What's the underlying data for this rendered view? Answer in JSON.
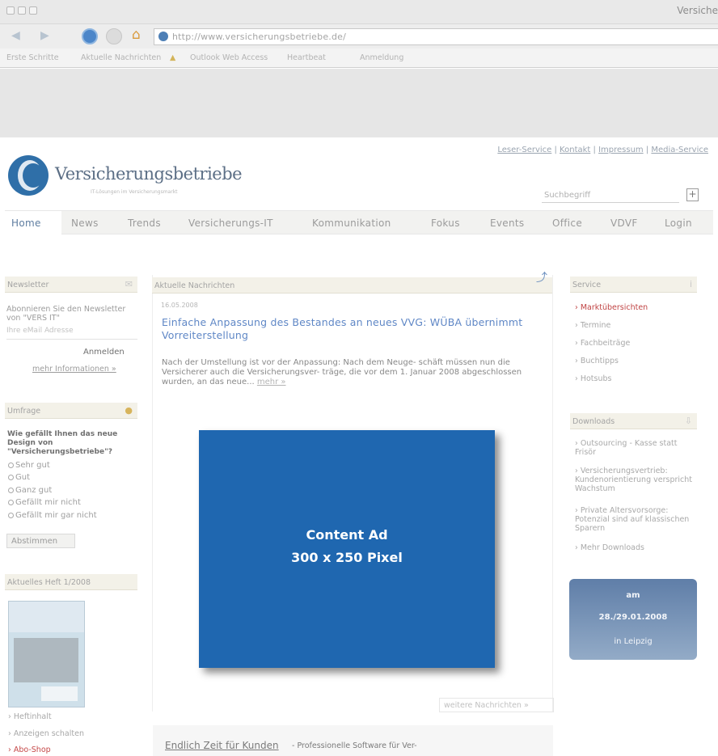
{
  "browser": {
    "window_title": "Versiche",
    "url": "http://www.versicherungsbetriebe.de/",
    "bookmarks": [
      "Erste Schritte",
      "Aktuelle Nachrichten",
      "Outlook Web Access",
      "Heartbeat",
      "Anmeldung"
    ]
  },
  "header": {
    "top_links": [
      "Leser-Service",
      "Kontakt",
      "Impressum",
      "Media-Service"
    ],
    "logo_text": "Versicherungsbetriebe",
    "logo_sub": "IT-Lösungen im Versicherungsmarkt",
    "search_placeholder": "Suchbegriff",
    "search_button": "+"
  },
  "nav": [
    "Home",
    "News",
    "Trends",
    "Versicherungs-IT",
    "Kommunikation",
    "Fokus",
    "Events",
    "Office",
    "VDVF",
    "Login"
  ],
  "left": {
    "newsletter": {
      "title": "Newsletter",
      "text": "Abonnieren Sie den Newsletter von \"VERS IT\"",
      "placeholder": "Ihre eMail Adresse",
      "button": "Anmelden",
      "more": "mehr Informationen »"
    },
    "poll": {
      "title": "Umfrage",
      "question": "Wie gefällt Ihnen das neue Design von \"Versicherungsbetriebe\"?",
      "options": [
        "Sehr gut",
        "Gut",
        "Ganz gut",
        "Gefällt mir nicht",
        "Gefällt mir gar nicht"
      ],
      "button": "Abstimmen"
    },
    "issue": {
      "title": "Aktuelles Heft 1/2008",
      "links": [
        "Heftinhalt",
        "Anzeigen schalten",
        "Abo-Shop"
      ]
    }
  },
  "main": {
    "section_title": "Aktuelle Nachrichten",
    "date": "16.05.2008",
    "article_title": "Einfache Anpassung des Bestandes an neues VVG: WÜBA übernimmt Vorreiterstellung",
    "article_body": "Nach der Umstellung ist vor der Anpassung: Nach dem Neuge- schäft müssen nun die Versicherer auch die Versicherungsver- träge, die vor dem 1. Januar 2008 abgeschlossen wurden, an das neue...",
    "more_link": "mehr »",
    "ad_line1": "Content Ad",
    "ad_line2": "300 x 250 Pixel",
    "more_news": "weitere Nachrichten »",
    "teaser_title": "Endlich Zeit für Kunden",
    "teaser_text": "- Professionelle Software für Ver-"
  },
  "right": {
    "service": {
      "title": "Service",
      "links": [
        "Marktübersichten",
        "Termine",
        "Fachbeiträge",
        "Buchtipps",
        "Hotsubs"
      ]
    },
    "downloads": {
      "title": "Downloads",
      "links": [
        "Outsourcing - Kasse statt Frisör",
        "Versicherungsvertrieb: Kundenorientierung verspricht Wachstum",
        "Private Altersvorsorge: Potenzial sind auf klassischen Sparern",
        "Mehr Downloads"
      ]
    },
    "event": {
      "label": "am",
      "date": "28./29.01.2008",
      "city": "in Leipzig"
    }
  }
}
